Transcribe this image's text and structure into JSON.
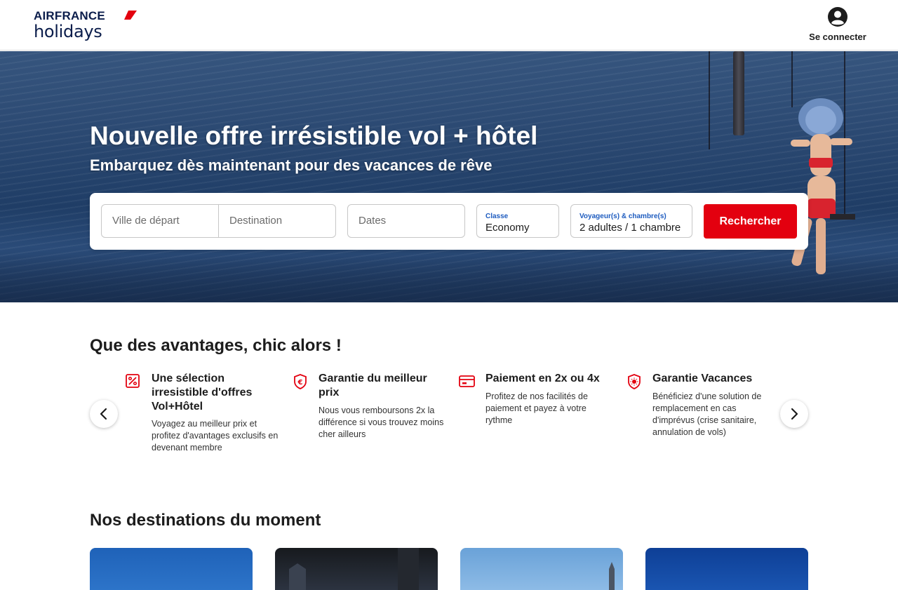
{
  "header": {
    "logo_brand": "AIRFRANCE",
    "logo_sub": "holidays",
    "login_label": "Se connecter"
  },
  "hero": {
    "title": "Nouvelle offre irrésistible vol + hôtel",
    "subtitle": "Embarquez dès maintenant pour des vacances de rêve"
  },
  "search": {
    "depart_placeholder": "Ville de départ",
    "destination_placeholder": "Destination",
    "dates_placeholder": "Dates",
    "class_label": "Classe",
    "class_value": "Economy",
    "pax_label": "Voyageur(s) & chambre(s)",
    "pax_value": "2 adultes / 1 chambre",
    "submit_label": "Rechercher"
  },
  "advantages": {
    "title": "Que des avantages, chic alors !",
    "items": [
      {
        "icon": "percent-tag-icon",
        "title": "Une sélection irresistible d'offres Vol+Hôtel",
        "text": "Voyagez au meilleur prix et profitez d'avantages exclusifs en devenant membre"
      },
      {
        "icon": "euro-shield-icon",
        "title": "Garantie du meilleur prix",
        "text": "Nous vous remboursons 2x la différence si vous trouvez moins cher ailleurs"
      },
      {
        "icon": "credit-card-icon",
        "title": "Paiement en 2x ou 4x",
        "text": "Profitez de nos facilités de paiement et payez à votre rythme"
      },
      {
        "icon": "sun-shield-icon",
        "title": "Garantie Vacances",
        "text": "Bénéficiez d'une solution de remplacement en cas d'imprévus (crise sanitaire, annulation de vols)"
      }
    ]
  },
  "destinations": {
    "title": "Nos destinations du moment"
  },
  "colors": {
    "accent_red": "#e3000f",
    "brand_navy": "#0b1d4b",
    "label_blue": "#1d5bbf"
  }
}
